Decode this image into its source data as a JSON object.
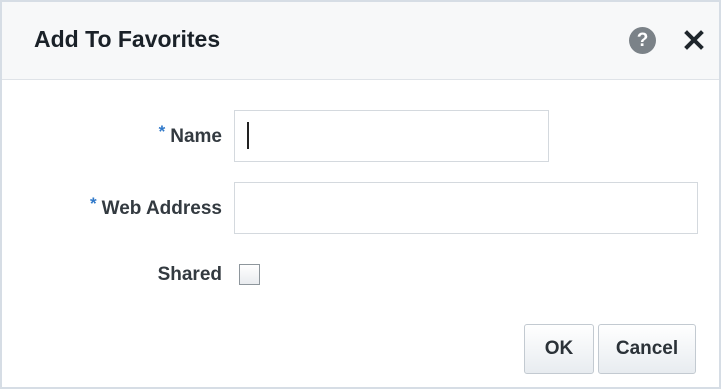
{
  "dialog": {
    "title": "Add To Favorites",
    "help_icon_glyph": "?",
    "help_icon": "help-circle-icon",
    "close_icon": "close-icon"
  },
  "form": {
    "name": {
      "required_marker": "*",
      "label": "Name",
      "value": ""
    },
    "web_address": {
      "required_marker": "*",
      "label": "Web Address",
      "value": ""
    },
    "shared": {
      "label": "Shared",
      "checked": false
    }
  },
  "buttons": {
    "ok_label": "OK",
    "cancel_label": "Cancel"
  },
  "colors": {
    "required_marker": "#2f78c9",
    "title_bar": "#f7f8f9",
    "help_icon": "#7b8288"
  }
}
